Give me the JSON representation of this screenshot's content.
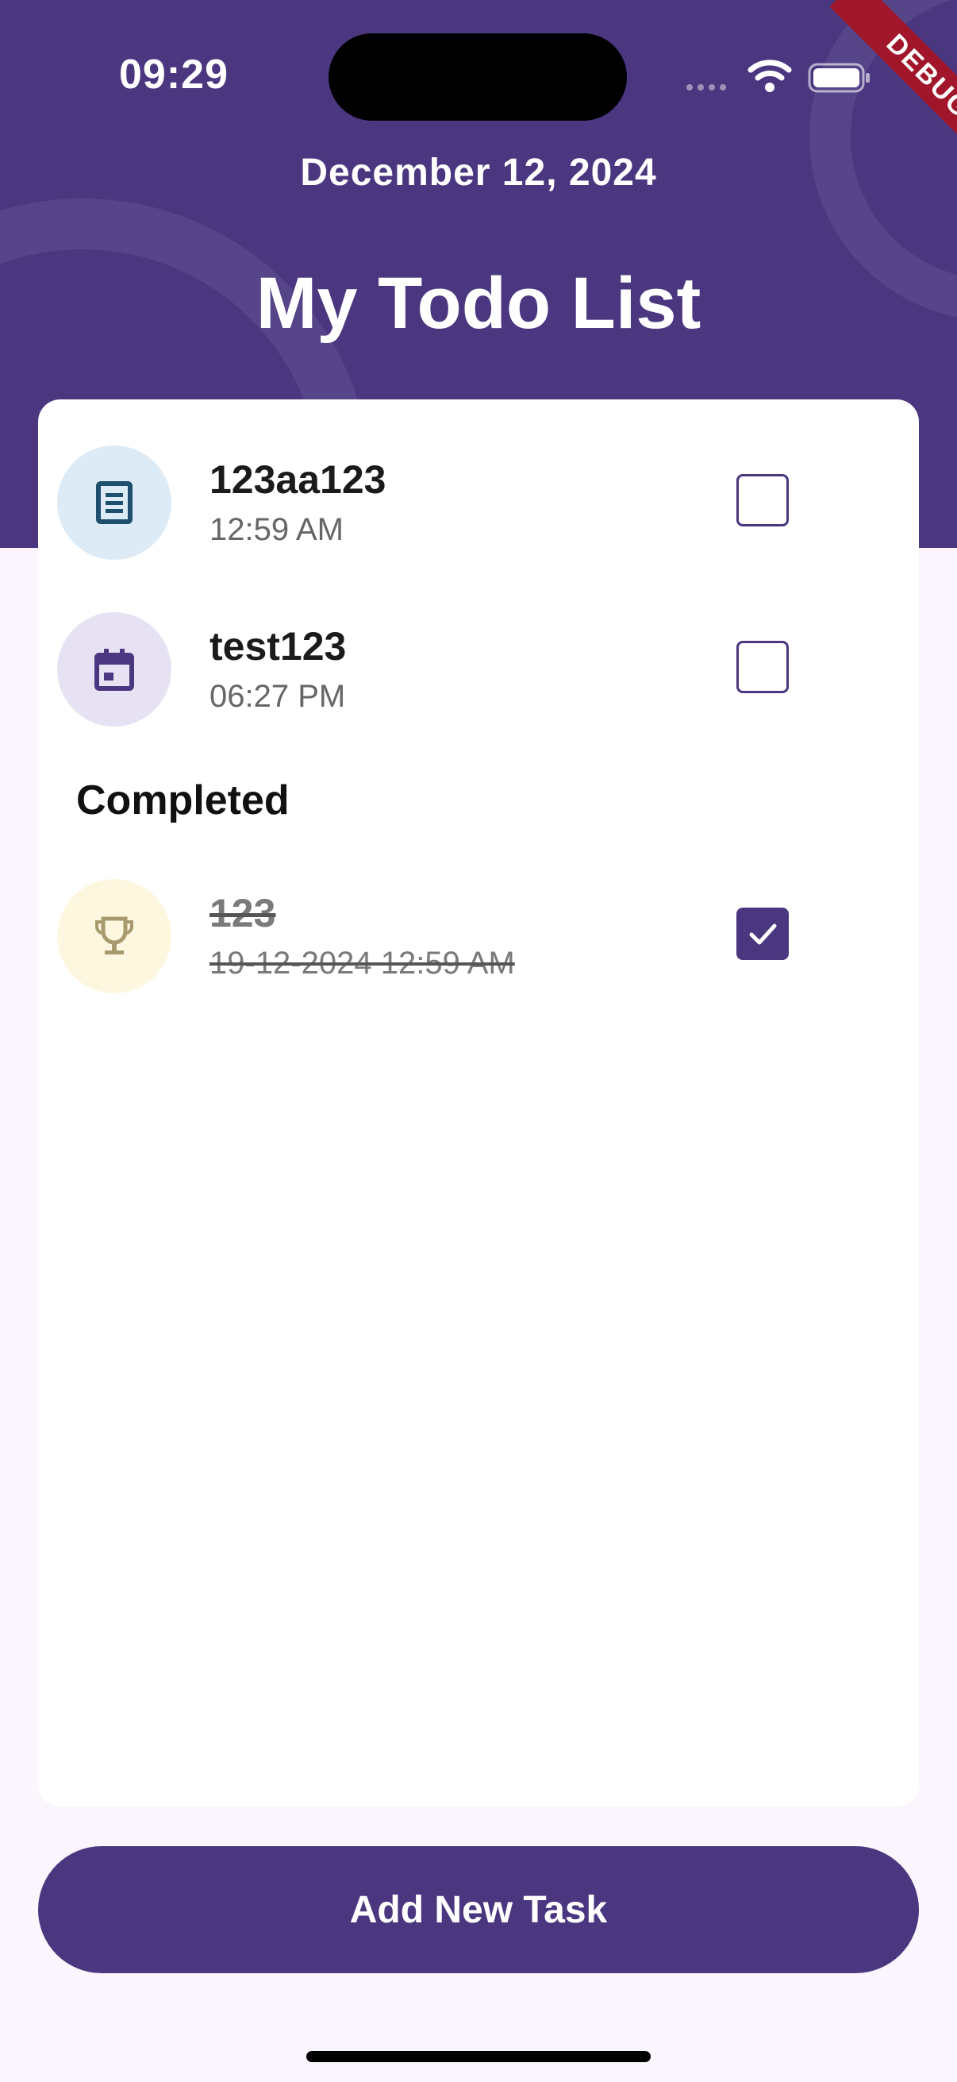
{
  "status_bar": {
    "time": "09:29",
    "debug_label": "DEBUG"
  },
  "header": {
    "date": "December 12, 2024",
    "title": "My Todo List"
  },
  "tasks": [
    {
      "title": "123aa123",
      "time": "12:59 AM",
      "icon": "document-icon",
      "icon_bg": "#dcebf6",
      "icon_color": "#1f4e6e",
      "checked": false
    },
    {
      "title": "test123",
      "time": "06:27 PM",
      "icon": "calendar-icon",
      "icon_bg": "#e7e2f3",
      "icon_color": "#4a3780",
      "checked": false
    }
  ],
  "completed_heading": "Completed",
  "completed_tasks": [
    {
      "title": "123",
      "time": "19-12-2024 12:59 AM",
      "icon": "trophy-icon",
      "icon_bg": "#fef7e0",
      "icon_color": "#a89a6e",
      "checked": true
    }
  ],
  "add_button": {
    "label": "Add New Task"
  },
  "colors": {
    "primary": "#4a3780",
    "background": "#fbf6fd",
    "debug_banner": "#a1162a"
  }
}
